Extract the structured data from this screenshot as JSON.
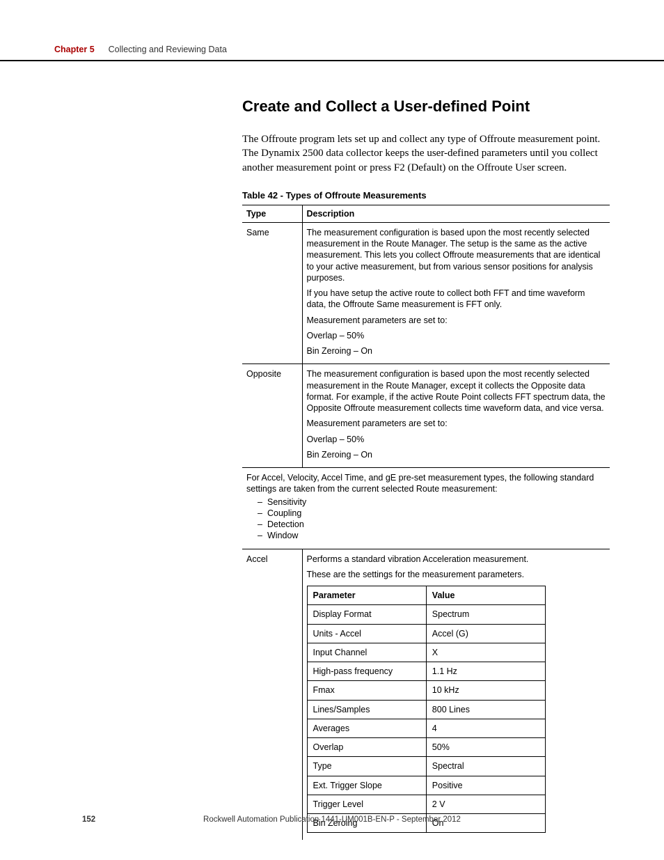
{
  "header": {
    "chapter_label": "Chapter 5",
    "chapter_title": "Collecting and Reviewing Data"
  },
  "section": {
    "heading": "Create and Collect a User-defined Point",
    "intro": "The Offroute program lets set up and collect any type of Offroute measurement point. The Dynamix 2500 data collector keeps the user-defined parameters until you collect another measurement point or press F2 (Default) on the Offroute User screen.",
    "table_caption": "Table 42 - Types of Offroute Measurements"
  },
  "table_headers": {
    "type": "Type",
    "description": "Description",
    "parameter": "Parameter",
    "value": "Value"
  },
  "rows": {
    "same": {
      "label": "Same",
      "p1": "The measurement configuration is based upon the most recently selected measurement in the Route Manager. The setup is the same as the active measurement. This lets you collect Offroute measurements that are identical to your active measurement, but from various sensor positions for analysis purposes.",
      "p2": "If you have setup the active route to collect both FFT and time waveform data, the Offroute Same measurement is FFT only.",
      "p3": "Measurement parameters are set to:",
      "p4": "Overlap – 50%",
      "p5": "Bin Zeroing – On"
    },
    "opposite": {
      "label": "Opposite",
      "p1": "The measurement configuration is based upon the most recently selected measurement in the Route Manager, except it collects the Opposite data format. For example, if the active Route Point collects FFT spectrum data, the Opposite Offroute measurement collects time waveform data, and vice versa.",
      "p2": "Measurement parameters are set to:",
      "p3": "Overlap – 50%",
      "p4": "Bin Zeroing – On"
    },
    "note": {
      "line1": "For Accel, Velocity, Accel Time, and gE pre-set measurement types, the following standard settings are taken from the current selected Route measurement:",
      "b1": "Sensitivity",
      "b2": "Coupling",
      "b3": "Detection",
      "b4": "Window"
    },
    "accel": {
      "label": "Accel",
      "p1": "Performs a standard vibration Acceleration measurement.",
      "p2": "These are the settings for the measurement parameters."
    }
  },
  "params": [
    {
      "p": "Display Format",
      "v": "Spectrum"
    },
    {
      "p": "Units - Accel",
      "v": "Accel (G)"
    },
    {
      "p": "Input Channel",
      "v": "X"
    },
    {
      "p": "High-pass frequency",
      "v": "1.1 Hz"
    },
    {
      "p": "Fmax",
      "v": "10 kHz"
    },
    {
      "p": "Lines/Samples",
      "v": "800 Lines"
    },
    {
      "p": "Averages",
      "v": "4"
    },
    {
      "p": "Overlap",
      "v": "50%"
    },
    {
      "p": "Type",
      "v": "Spectral"
    },
    {
      "p": "Ext. Trigger Slope",
      "v": "Positive"
    },
    {
      "p": "Trigger Level",
      "v": "2 V"
    },
    {
      "p": "Bin Zeroing",
      "v": "On"
    }
  ],
  "footer": {
    "page": "152",
    "text": "Rockwell Automation Publication 1441-UM001B-EN-P - September 2012"
  }
}
